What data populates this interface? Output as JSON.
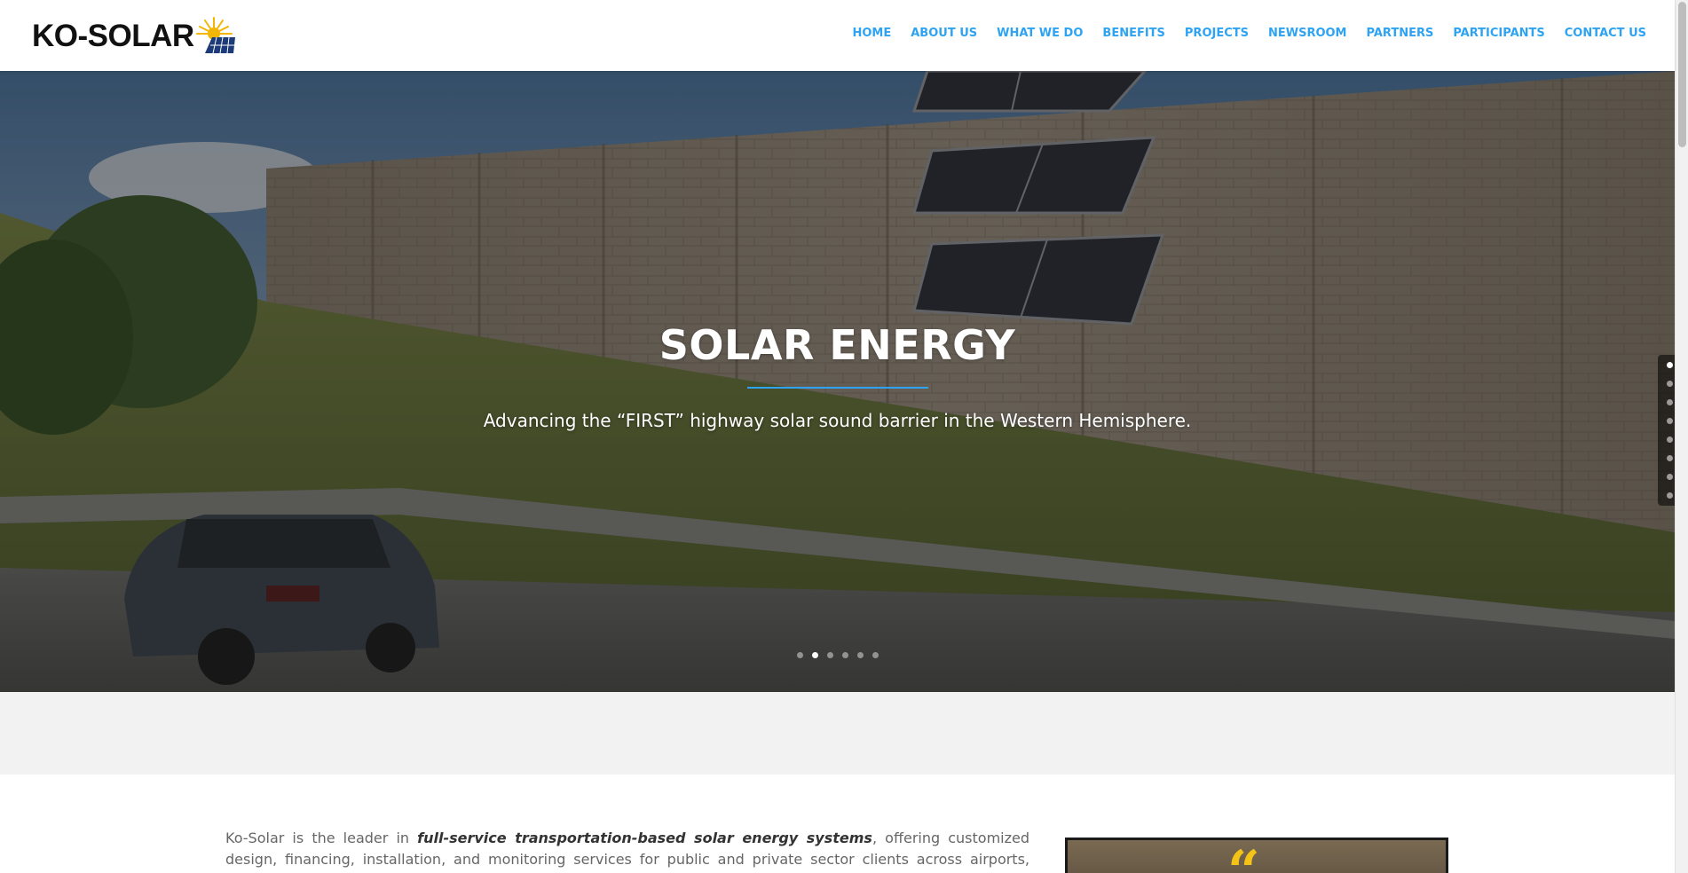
{
  "brand": {
    "logo_text": "KO-SOLAR",
    "accent": "#2ea3f2"
  },
  "nav": {
    "items": [
      {
        "label": "HOME"
      },
      {
        "label": "ABOUT US"
      },
      {
        "label": "WHAT WE DO"
      },
      {
        "label": "BENEFITS"
      },
      {
        "label": "PROJECTS"
      },
      {
        "label": "NEWSROOM"
      },
      {
        "label": "PARTNERS"
      },
      {
        "label": "PARTICIPANTS"
      },
      {
        "label": "CONTACT US"
      }
    ]
  },
  "hero": {
    "title": "SOLAR ENERGY",
    "subtitle": "Advancing the “FIRST” highway solar sound barrier in the Western Hemisphere.",
    "slide_count": 6,
    "active_slide": 2,
    "side_dot_count": 8,
    "active_side_dot": 1
  },
  "intro": {
    "text_before": "Ko-Solar is the leader in ",
    "text_emphasis": "full-service transportation-based solar energy systems",
    "text_after": ", offering customized design, financing, installation, and monitoring services for public and private sector clients across airports, highways, railroads, marine",
    "image_glyph": "“"
  }
}
